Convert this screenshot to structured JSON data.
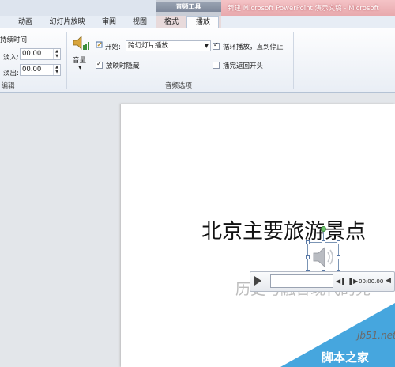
{
  "window": {
    "title": "新建 Microsoft PowerPoint 演示文稿 - Microsoft",
    "context_tab_group": "音频工具"
  },
  "tabs": [
    {
      "label": "动画"
    },
    {
      "label": "幻灯片放映"
    },
    {
      "label": "审阅"
    },
    {
      "label": "视图"
    },
    {
      "label": "格式"
    },
    {
      "label": "播放"
    }
  ],
  "active_tab": "播放",
  "ribbon": {
    "fade": {
      "heading": "持续时间",
      "fade_in_label": "淡入:",
      "fade_in_value": "00.00",
      "fade_out_label": "淡出:",
      "fade_out_value": "00.00",
      "group_label": "编辑"
    },
    "audio_options": {
      "volume_label": "音量",
      "start_label": "开始:",
      "start_value": "跨幻灯片播放",
      "hide_label": "放映时隐藏",
      "hide_checked": true,
      "loop_label": "循环播放，直到停止",
      "loop_checked": true,
      "rewind_label": "播完返回开头",
      "rewind_checked": false,
      "group_label": "音频选项"
    }
  },
  "slide": {
    "title": "北京主要旅游景点",
    "subtitle": "历史与融合现代的完"
  },
  "player": {
    "time": "00:00.00"
  },
  "watermark": {
    "site": "jb51.net",
    "name": "脚本之家"
  },
  "colors": {
    "title_bar_context": "#e8a9ad",
    "ribbon_bg": "#fdfdfe",
    "watermark_blue": "#46a6de"
  }
}
